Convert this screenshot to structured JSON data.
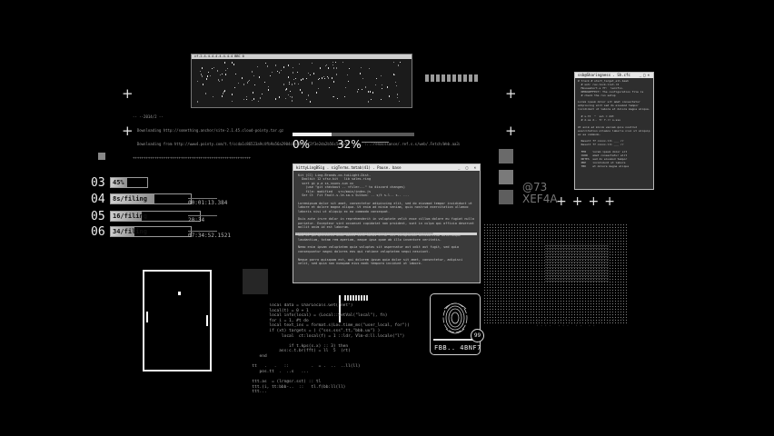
{
  "top_log": {
    "line1": "-- --2014/2 --",
    "line2": "  Downloading http://something.anchor/site-2.1.45.cloud-pointy.tar.gz",
    "line3": "  Downloading from http://www4.pointy.com/t.f/ccda1c86523a9c4fb9a56a2904c8e5be4ff2f3e2da2b56c5e5e34 _pfp_ :..:renaissance/.ref.s.s/web/.Fetch/Web.aa3a9b9e59b00a1e1b0c",
    "line4": "++++++++++++++++++++++++++++++++++++++++++++++++++++++"
  },
  "top_window": {
    "title": "cf.2.4.4.4.4.4.4.4.4 BBC 0"
  },
  "progress": {
    "start_label": "0%",
    "value_label": "32%",
    "value": 0.32
  },
  "stats": [
    {
      "num": "03",
      "label": "45%",
      "time": "",
      "value": 0.45
    },
    {
      "num": "04",
      "label": "8s/filing",
      "time": "00:01:13.384",
      "value": 0.55
    },
    {
      "num": "05",
      "label": "16/filing",
      "time": "20:34",
      "value": 0.35
    },
    {
      "num": "06",
      "label": "34/filing",
      "time": "07:34:52.1521",
      "value": 0.3
    }
  ],
  "center_window": {
    "title": "kittyLingBSig . sigTerms.tmtab(41) . Pause. base",
    "body": "Kit (CC) Ling.Brands.co.tuiLight.Dist.\n  Doolkit 12 sfsv.kit   lib sales.ring\n  sort gi p.a ss_ssuns.sun xx\n    (use \"git checkout -- <file>...\" to discard changes)\n    file: modified   src/main/index.js\n  Ser Ct  Fit Fault.s.le.sa.s Sulkon: .. s/t s.l.. s.. ...\n\nLoremipsum dolor sit amet, consectetur adipiscing elit, sed do eiusmod tempor incididunt ut labore et dolore magna aliqua. Ut enim ad minim veniam, quis nostrud exercitation ullamco laboris nisi ut aliquip ex ea commodo consequat.\n\nDuis aute irure dolor in reprehenderit in voluptate velit esse cillum dolore eu fugiat nulla pariatur. Excepteur sint occaecat cupidatat non proident, sunt in culpa qui officia deserunt mollit anim id est laborum.\n\nSed ut perspiciatis unde omnis iste natus error sit voluptatem accusantium doloremque laudantium, totam rem aperiam, eaque ipsa quae ab illo inventore veritatis.\n\nNemo enim ipsam voluptatem quia voluptas sit aspernatur aut odit aut fugit, sed quia consequuntur magni dolores eos qui ratione voluptatem sequi nesciunt.\n\nNeque porro quisquam est, qui dolorem ipsum quia dolor sit amet, consectetur, adipisci velit, sed quia non numquam eius modi tempora incidunt ut labore.",
    "highlight": "===================================================================================="
  },
  "right_window": {
    "title": "ssb@Sharingness . Sh.cfc",
    "body": "# track # start_target_all.bash\n  # ssh: rev-lock-list-r2\n  Mouseshort.s ff:  lerofix.\n  DEBUGEFFECT: The configuration file is\n  # check the run setup\n\nLorem ipsum dolor sit amet consectetur adipiscing elit sed do eiusmod tempor incididunt ut labore et dolore magna aliqua.\n\n  # s.tt  ^  ssl = ddt\n  # d.ss d.. fr f.rr s-sss\n\nUt enim ad minim veniam quis nostrud exercitation ullamco laboris nisi ut aliquip ex ea commodo.\n\n  Result ff cxxxx-lll ___ rr\n  Result ff cxxxx-lll ___ rr\n\n  FEB    lorem ipsum dolor sit\n  CURR   amet consectetur elit\n  NOTES  sed do eiusmod tempor\n  PRE    incididunt ut labore\n  TBD    et dolore magna aliqua"
  },
  "hex_readout": {
    "line1": "@73",
    "line2": "XEF4A"
  },
  "fingerprint": {
    "badge": "99",
    "code": "FBB.. 4BNF7"
  },
  "code_block": {
    "lines": [
      "         local data = CharLocals.Get(\"net\")",
      "         local(t) = 0 + 1",
      "         local info(local) = (Local::SetVal(\"local\"), fn)",
      "         for i = 1, #t do",
      "         local text_ins = format.s(Loc.time_ms(\"user_local, for\"))",
      "         if (xt) targets = ( {\"sss.sss\".tt,\"bbb.uu\"} )",
      "              local  ct:local(f) = 1 ::ldr, Vlm-d:ll.locale(\"l\")",
      "",
      "                 if t.kps(s.x) :: 3) then",
      "             ass:c.t.br(fft) = ll  5  (rt)",
      "     end",
      "",
      "  tt   .   .   ::         .  = .  ..  ..ll(ll)",
      "     pos.tt  .  ..s   ...",
      "",
      "  ttt.as  = (lrn@sr.sst) :: tl",
      "  ttt.(i, tt:bbb-..  ::   tl.f(bb:ll(ll)",
      "  ttt..."
    ]
  },
  "matrix_text": ": .  '  .  : .:  ' .  :  . ' :  .  . :  ' . :  .  ' : .  :  . ' . : . '  :  .  ' . :"
}
